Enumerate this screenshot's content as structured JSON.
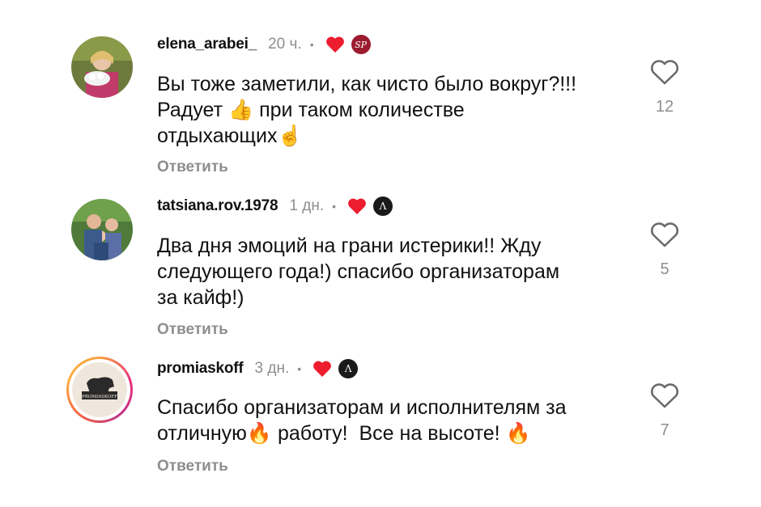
{
  "comments": [
    {
      "username": "elena_arabei_",
      "time": "20 ч.",
      "badge": "SP",
      "text": "Вы тоже заметили, как чисто было вокруг?!!!\nРадует 👍 при таком количестве\nотдыхающих☝️",
      "reply": "Ответить",
      "likes": "12"
    },
    {
      "username": "tatsiana.rov.1978",
      "time": "1 дн.",
      "badge": "Λ",
      "text": "Два дня эмоций на грани истерики!! Жду\nследующего года!) спасибо организаторам\nза кайф!)",
      "reply": "Ответить",
      "likes": "5"
    },
    {
      "username": "promiaskoff",
      "time": "3 дн.",
      "badge": "Λ",
      "text": "Спасибо организаторам и исполнителям за\nотличную🔥 работу!  Все на высоте! 🔥",
      "reply": "Ответить",
      "likes": "7",
      "avatar_text": "PROMIASKOFF"
    }
  ],
  "separator": "•",
  "colors": {
    "liked_heart": "#ed1c2e",
    "muted": "#8e8e8e",
    "sp_badge": "#9b1c2e"
  },
  "icons": {
    "like": "heart-outline-icon",
    "author_liked": "heart-filled-icon"
  }
}
